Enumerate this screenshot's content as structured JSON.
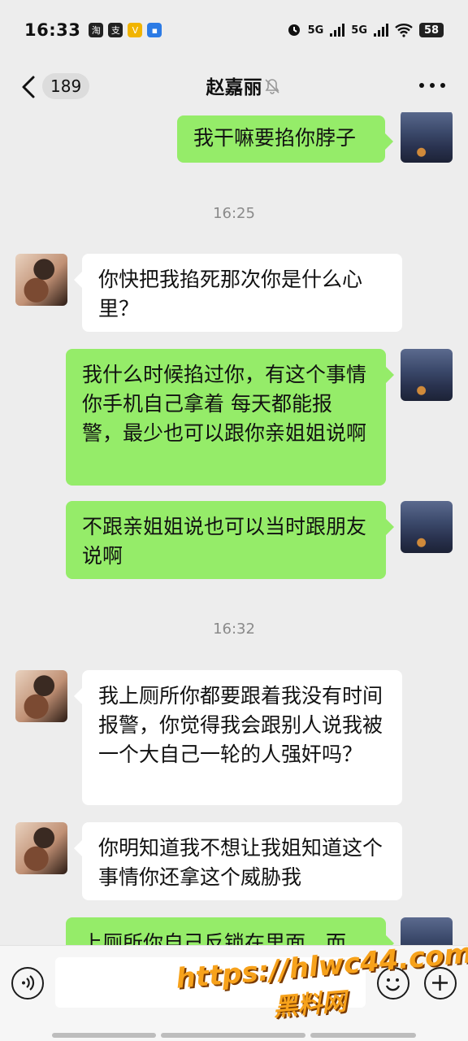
{
  "status_bar": {
    "time": "16:33",
    "app_icons": [
      "淘",
      "支",
      "V",
      "▪"
    ],
    "network_1": "5G",
    "network_2": "5G",
    "battery": "58"
  },
  "header": {
    "unread_count": "189",
    "title": "赵嘉丽"
  },
  "messages": [
    {
      "side": "right",
      "text": "我干嘛要掐你脖子"
    },
    {
      "type": "time",
      "text": "16:25"
    },
    {
      "side": "left",
      "text": "你快把我掐死那次你是什么心里？"
    },
    {
      "side": "right",
      "text": "我什么时候掐过你，有这个事情你手机自己拿着 每天都能报警，最少也可以跟你亲姐姐说啊"
    },
    {
      "side": "right",
      "text": "不跟亲姐姐说也可以当时跟朋友说啊"
    },
    {
      "type": "time",
      "text": "16:32"
    },
    {
      "side": "left",
      "text": "我上厕所你都要跟着我没有时间报警，你觉得我会跟别人说我被一个大自己一轮的人强奸吗？"
    },
    {
      "side": "left",
      "text": "你明知道我不想让我姐知道这个事情你还拿这个威胁我"
    },
    {
      "side": "right",
      "text": "上厕所你自己反锁在里面，而"
    }
  ],
  "watermark": {
    "url": "https://hlwc44.com",
    "name": "黑料网"
  },
  "colors": {
    "background": "#ededed",
    "sent_bubble": "#95ec69",
    "received_bubble": "#ffffff",
    "watermark": "#f7a21b"
  }
}
